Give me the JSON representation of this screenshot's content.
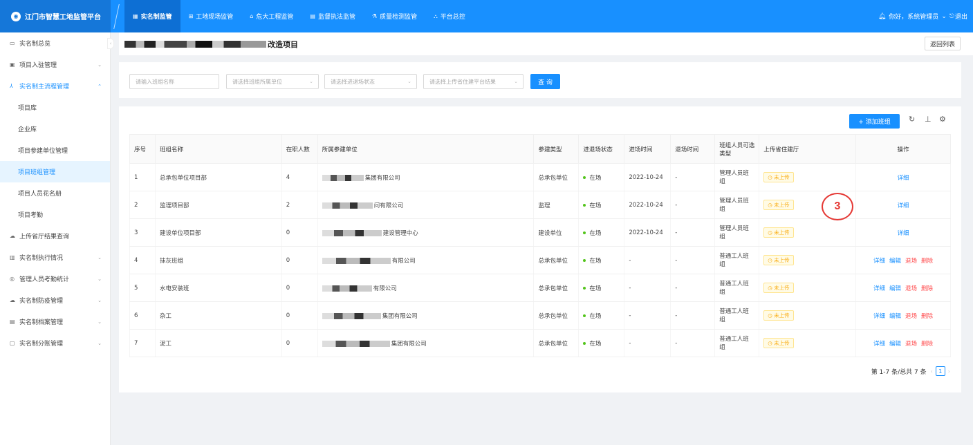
{
  "app": {
    "title": "江门市智慧工地监管平台"
  },
  "topnav": [
    {
      "icon": "grid-icon",
      "label": "实名制监管",
      "active": true
    },
    {
      "icon": "grid-icon",
      "label": "工地现场监管"
    },
    {
      "icon": "building-icon",
      "label": "危大工程监管"
    },
    {
      "icon": "document-icon",
      "label": "监督执法监管"
    },
    {
      "icon": "flask-icon",
      "label": "质量检测监管"
    },
    {
      "icon": "platform-icon",
      "label": "平台总控"
    }
  ],
  "user": {
    "greeting": "你好，系统管理员",
    "logout": "退出"
  },
  "sidebar": {
    "items": [
      {
        "label": "实名制总览"
      },
      {
        "label": "项目入驻管理"
      },
      {
        "label": "实名制主流程管理"
      },
      {
        "label": "项目库"
      },
      {
        "label": "企业库"
      },
      {
        "label": "项目参建单位管理"
      },
      {
        "label": "项目班组管理"
      },
      {
        "label": "项目人员花名册"
      },
      {
        "label": "项目考勤"
      },
      {
        "label": "上传省厅结果查询"
      },
      {
        "label": "实名制执行情况"
      },
      {
        "label": "管理人员考勤统计"
      },
      {
        "label": "实名制防疫管理"
      },
      {
        "label": "实名制档案管理"
      },
      {
        "label": "实名制分账管理"
      }
    ]
  },
  "page": {
    "title": "改造项目",
    "back": "返回列表"
  },
  "filters": {
    "team_name": "请输入班组名称",
    "unit": "请选择班组所属单位",
    "status": "请选择进退场状态",
    "upload": "请选择上传省住建平台结果",
    "query": "查 询"
  },
  "toolbar": {
    "add": "+ 添加班组"
  },
  "table": {
    "headers": [
      "序号",
      "班组名称",
      "在职人数",
      "所属参建单位",
      "参建类型",
      "进退场状态",
      "进场时间",
      "退场时间",
      "班组人员可选类型",
      "上传省住建厅",
      "操作"
    ],
    "rows": [
      {
        "no": "1",
        "name": "总承包单位项目部",
        "count": "4",
        "unit": "集团有限公司",
        "type": "总承包单位",
        "status": "在场",
        "in": "2022-10-24",
        "out": "-",
        "kind": "管理人员班组",
        "upload": "未上传",
        "ops": [
          "详细"
        ]
      },
      {
        "no": "2",
        "name": "监理项目部",
        "count": "2",
        "unit": "问有限公司",
        "type": "监理",
        "status": "在场",
        "in": "2022-10-24",
        "out": "-",
        "kind": "管理人员班组",
        "upload": "未上传",
        "ops": [
          "详细"
        ]
      },
      {
        "no": "3",
        "name": "建设单位项目部",
        "count": "0",
        "unit": "建设管理中心",
        "type": "建设单位",
        "status": "在场",
        "in": "2022-10-24",
        "out": "-",
        "kind": "管理人员班组",
        "upload": "未上传",
        "ops": [
          "详细"
        ]
      },
      {
        "no": "4",
        "name": "抹灰班组",
        "count": "0",
        "unit": "有限公司",
        "type": "总承包单位",
        "status": "在场",
        "in": "-",
        "out": "-",
        "kind": "普通工人班组",
        "upload": "未上传",
        "ops": [
          "详细",
          "编辑",
          "退场",
          "删除"
        ]
      },
      {
        "no": "5",
        "name": "水电安装班",
        "count": "0",
        "unit": "有限公司",
        "type": "总承包单位",
        "status": "在场",
        "in": "-",
        "out": "-",
        "kind": "普通工人班组",
        "upload": "未上传",
        "ops": [
          "详细",
          "编辑",
          "退场",
          "删除"
        ]
      },
      {
        "no": "6",
        "name": "杂工",
        "count": "0",
        "unit": "集团有限公司",
        "type": "总承包单位",
        "status": "在场",
        "in": "-",
        "out": "-",
        "kind": "普通工人班组",
        "upload": "未上传",
        "ops": [
          "详细",
          "编辑",
          "退场",
          "删除"
        ]
      },
      {
        "no": "7",
        "name": "泥工",
        "count": "0",
        "unit": "集团有限公司",
        "type": "总承包单位",
        "status": "在场",
        "in": "-",
        "out": "-",
        "kind": "普通工人班组",
        "upload": "未上传",
        "ops": [
          "详细",
          "编辑",
          "退场",
          "删除"
        ]
      }
    ]
  },
  "pagination": {
    "summary": "第 1-7 条/总共 7 条",
    "current": "1"
  },
  "annotation": {
    "label": "3"
  },
  "colors": {
    "primary": "#1890ff",
    "danger": "#ff4d4f",
    "success": "#52c41a",
    "warning": "#faad14",
    "marker": "#e53935"
  }
}
